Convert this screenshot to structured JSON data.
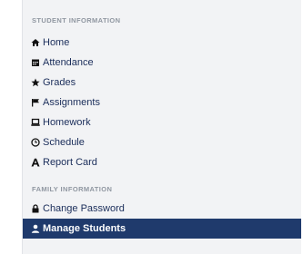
{
  "sections": [
    {
      "title": "STUDENT INFORMATION",
      "items": [
        {
          "label": "Home",
          "icon": "home-icon"
        },
        {
          "label": "Attendance",
          "icon": "calendar-icon"
        },
        {
          "label": "Grades",
          "icon": "star-icon"
        },
        {
          "label": "Assignments",
          "icon": "flag-icon"
        },
        {
          "label": "Homework",
          "icon": "laptop-icon"
        },
        {
          "label": "Schedule",
          "icon": "clock-icon"
        },
        {
          "label": "Report Card",
          "icon": "report-card-icon"
        }
      ]
    },
    {
      "title": "FAMILY INFORMATION",
      "items": [
        {
          "label": "Change Password",
          "icon": "lock-icon"
        },
        {
          "label": "Manage Students",
          "icon": "user-icon",
          "active": true
        }
      ]
    }
  ],
  "colors": {
    "active_bg": "#1f3a6c",
    "panel_bg": "#f2f3f5",
    "link": "#1a2d5a"
  }
}
